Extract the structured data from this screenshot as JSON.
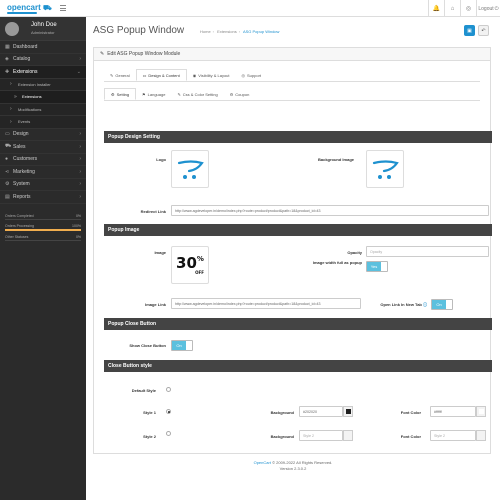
{
  "header": {
    "logo": "opencart",
    "logout": "Logout",
    "icons": [
      "bell-icon",
      "home-icon",
      "lifebuoy-icon"
    ]
  },
  "profile": {
    "name": "John Doe",
    "role": "Administrator"
  },
  "sidebar": {
    "items": [
      {
        "label": "Dashboard",
        "icon": "dashboard-icon",
        "chevron": false
      },
      {
        "label": "Catalog",
        "icon": "tag-icon",
        "chevron": true
      },
      {
        "label": "Extensions",
        "icon": "puzzle-icon",
        "chevron": true
      },
      {
        "label": "Extension Installer",
        "chevron": false
      },
      {
        "label": "Extensions",
        "chevron": false
      },
      {
        "label": "Modifications",
        "chevron": false
      },
      {
        "label": "Events",
        "chevron": false
      },
      {
        "label": "Design",
        "icon": "monitor-icon",
        "chevron": true
      },
      {
        "label": "Sales",
        "icon": "cart-icon",
        "chevron": true
      },
      {
        "label": "Customers",
        "icon": "user-icon",
        "chevron": true
      },
      {
        "label": "Marketing",
        "icon": "share-icon",
        "chevron": true
      },
      {
        "label": "System",
        "icon": "gear-icon",
        "chevron": true
      },
      {
        "label": "Reports",
        "icon": "chart-icon",
        "chevron": true
      }
    ],
    "stats": [
      {
        "label": "Orders Completed",
        "value": "0%",
        "fraction": 0.0,
        "color": "#4cae4c"
      },
      {
        "label": "Orders Processing",
        "value": "100%",
        "fraction": 1.0,
        "color": "#f0ad4e"
      },
      {
        "label": "Other Statuses",
        "value": "0%",
        "fraction": 0.0,
        "color": "#d9534f"
      }
    ]
  },
  "page": {
    "title": "ASG Popup Window",
    "breadcrumb": [
      "Home",
      "Extensions",
      "ASG Popup Window"
    ]
  },
  "panel": {
    "heading": "Edit ASG Popup Window Module",
    "tabs": [
      "General",
      "Design & Content",
      "Visibility & Layout",
      "Support"
    ],
    "active_tab": "Design & Content",
    "subtabs": [
      "Setting",
      "Language",
      "Css & Color Setting",
      "Coupon"
    ],
    "active_subtab": "Setting"
  },
  "sections": {
    "design": "Popup Design Setting",
    "image": "Popup Image",
    "close_button": "Popup Close Button",
    "close_style": "Close Button style"
  },
  "design": {
    "logo_label": "Logo",
    "bg_label": "Background Image",
    "redirect_label": "Redirect Link",
    "redirect_value": "http://www.agdeveloper.in/demo/index.php?route=product/product&path=18&product_id=43"
  },
  "image": {
    "image_label": "Image",
    "opacity_label": "Opacity",
    "opacity_placeholder": "Opacity",
    "full_label": "Image width full as popup",
    "full_value": "Yes",
    "link_label": "Image Link",
    "link_value": "http://www.agdeveloper.in/demo/index.php?route=product/product&path=18&product_id=43",
    "newtab_label": "Open Link In New Tab",
    "newtab_value": "On",
    "promo_big": "30",
    "promo_small": "%",
    "promo_word": "OFF"
  },
  "close": {
    "show_label": "Show Close Button",
    "show_value": "On"
  },
  "style": {
    "default_label": "Default Style",
    "style1_label": "Style 1",
    "style2_label": "Style 2",
    "bg_label": "Background",
    "font_label": "Font Color",
    "style1_bg": "#202020",
    "style1_font": "#ffffff",
    "style2_bg_placeholder": "Style 2",
    "style2_font_placeholder": "Style 2",
    "swatch_dark": "#202020",
    "swatch_light": "#ffffff"
  },
  "footer": {
    "brand": "OpenCart",
    "copy": "© 2009-2022 All Rights Reserved.",
    "version": "Version 2.3.0.2"
  },
  "colors": {
    "accent": "#1e91cf",
    "sidebar": "#2b2b2b",
    "section": "#444444",
    "toggle_on": "#5bc0de"
  }
}
